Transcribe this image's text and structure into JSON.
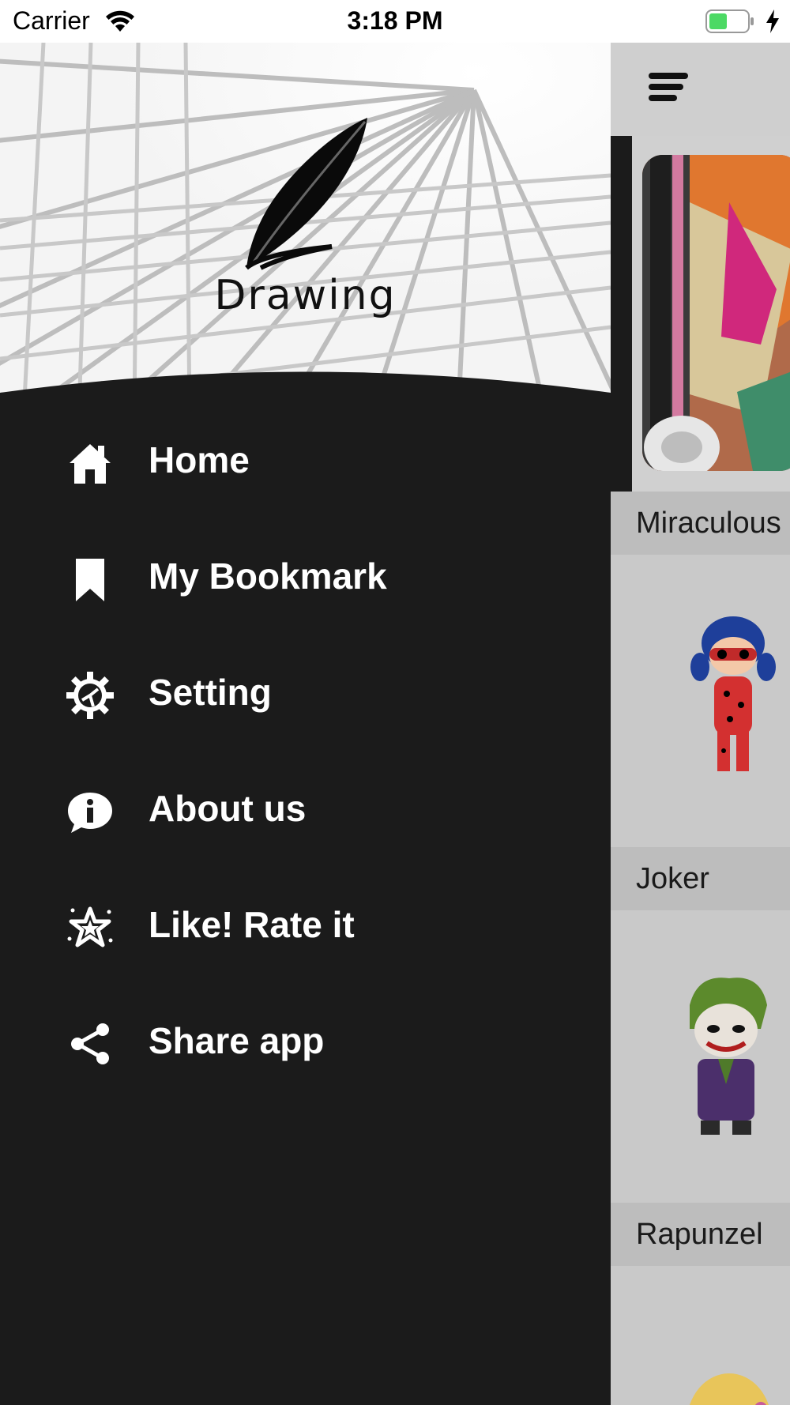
{
  "status_bar": {
    "carrier": "Carrier",
    "time": "3:18 PM",
    "battery_color": "#4cd964"
  },
  "drawer": {
    "app_name": "Drawing",
    "background": "#1b1b1b",
    "items": [
      {
        "label": "Home",
        "icon": "home-icon"
      },
      {
        "label": "My Bookmark",
        "icon": "bookmark-icon"
      },
      {
        "label": "Setting",
        "icon": "gear-icon"
      },
      {
        "label": "About us",
        "icon": "info-icon"
      },
      {
        "label": "Like! Rate it",
        "icon": "star-icon"
      },
      {
        "label": "Share app",
        "icon": "share-icon"
      }
    ]
  },
  "content": {
    "menu_icon": "hamburger-menu-icon",
    "sections": [
      {
        "title": "Miraculous"
      },
      {
        "title": "Joker"
      },
      {
        "title": "Rapunzel"
      }
    ]
  }
}
